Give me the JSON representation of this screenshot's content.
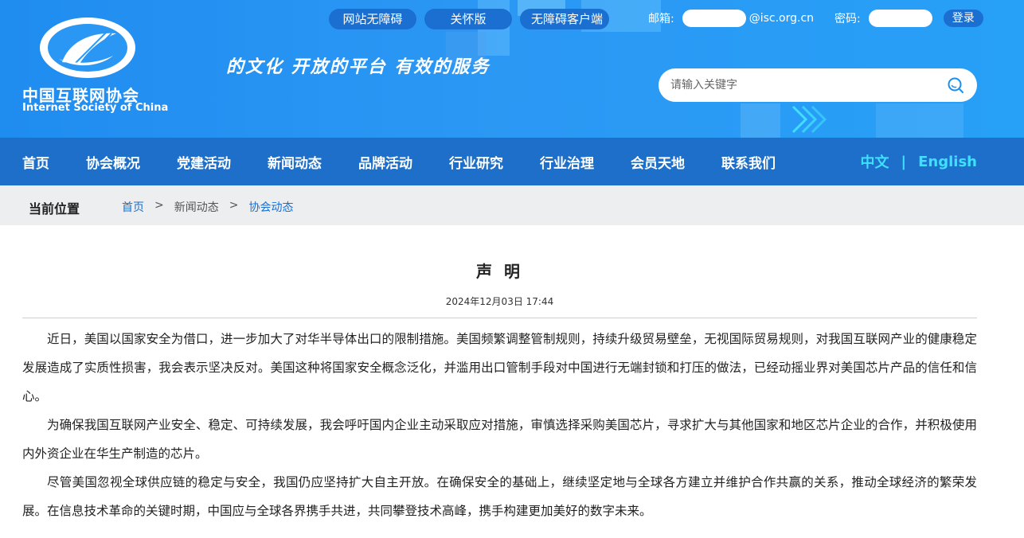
{
  "header": {
    "logo_cn": "中国互联网协会",
    "logo_en": "Internet Society of China",
    "slogan": "的文化  开放的平台  有效的服务",
    "top_links": [
      "网站无障碍",
      "关怀版",
      "无障碍客户端"
    ],
    "login": {
      "email_label": "邮箱:",
      "email_domain": "@isc.org.cn",
      "password_label": "密码:",
      "login_button": "登录"
    },
    "search": {
      "placeholder": "请输入关键字"
    }
  },
  "nav": {
    "items": [
      "首页",
      "协会概况",
      "党建活动",
      "新闻动态",
      "品牌活动",
      "行业研究",
      "行业治理",
      "会员天地",
      "联系我们"
    ],
    "lang_cn": "中文",
    "lang_sep": "|",
    "lang_en": "English"
  },
  "breadcrumb": {
    "title": "当前位置",
    "items": [
      "首页",
      "新闻动态",
      "协会动态"
    ],
    "separator": ">"
  },
  "article": {
    "title": "声 明",
    "date": "2024年12月03日 17:44",
    "paragraphs": [
      "近日，美国以国家安全为借口，进一步加大了对华半导体出口的限制措施。美国频繁调整管制规则，持续升级贸易壁垒，无视国际贸易规则，对我国互联网产业的健康稳定发展造成了实质性损害，我会表示坚决反对。美国这种将国家安全概念泛化，并滥用出口管制手段对中国进行无端封锁和打压的做法，已经动摇业界对美国芯片产品的信任和信心。",
      "为确保我国互联网产业安全、稳定、可持续发展，我会呼吁国内企业主动采取应对措施，审慎选择采购美国芯片，寻求扩大与其他国家和地区芯片企业的合作，并积极使用内外资企业在华生产制造的芯片。",
      "尽管美国忽视全球供应链的稳定与安全，我国仍应坚持扩大自主开放。在确保安全的基础上，继续坚定地与全球各方建立并维护合作共赢的关系，推动全球经济的繁荣发展。在信息技术革命的关键时期，中国应与全球各界携手共进，共同攀登技术高峰，携手构建更加美好的数字未来。"
    ]
  },
  "colors": {
    "header_blue": "#2b97f4",
    "nav_blue": "#1d6fc9",
    "lang_cyan": "#3fe0ff",
    "link_blue": "#1a6fd1",
    "breadcrumb_bg": "#edeef0"
  }
}
